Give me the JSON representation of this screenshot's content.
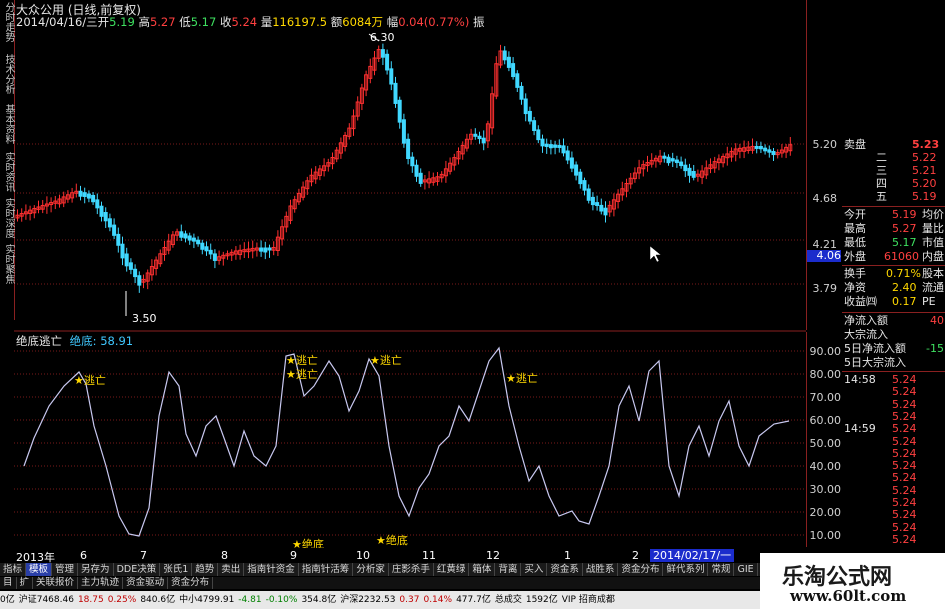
{
  "header": {
    "title": "大众公用 (日线,前复权)",
    "date": "2014/04/16/三",
    "open_label": "开",
    "open": "5.19",
    "high_label": "高",
    "high": "5.27",
    "low_label": "低",
    "low": "5.17",
    "close_label": "收",
    "close": "5.24",
    "volume_label": "量",
    "volume": "116197.5",
    "amount_label": "额",
    "amount": "6084万",
    "change_label": "幅",
    "change": "0.04(0.77%)",
    "amp_label": "振"
  },
  "left_tabs": [
    "分时走势",
    "技术分析",
    "基本资料",
    "实时资讯",
    "实时深度",
    "实时聚焦"
  ],
  "price_axis": [
    "5.20",
    "4.68",
    "4.21",
    "3.79"
  ],
  "current_price_tag": "4.06",
  "price_annotations": {
    "high": "6.30",
    "low": "3.50"
  },
  "oscillator": {
    "title": "绝底逃亡",
    "series_label": "绝底:",
    "series_value": "58.91",
    "axis": [
      "90.00",
      "80.00",
      "70.00",
      "60.00",
      "50.00",
      "40.00",
      "30.00",
      "20.00",
      "10.00"
    ],
    "escape_label": "★逃亡",
    "bottom_label": "★绝底"
  },
  "month_bar": [
    "2013年",
    "6",
    "7",
    "8",
    "9",
    "10",
    "11",
    "12",
    "1",
    "2"
  ],
  "date_tag": "2014/02/17/一",
  "panel": {
    "sell_label": "卖盘",
    "sell_price": "5.23",
    "sell_rows": [
      [
        "二",
        "5.22"
      ],
      [
        "三",
        "5.21"
      ],
      [
        "四",
        "5.20"
      ],
      [
        "五",
        "5.19"
      ]
    ],
    "stats": [
      [
        "今开",
        "5.19",
        "均价"
      ],
      [
        "最高",
        "5.27",
        "量比"
      ],
      [
        "最低",
        "5.17",
        "市值"
      ],
      [
        "外盘",
        "61060",
        "内盘"
      ],
      [
        "换手",
        "0.71%",
        "股本"
      ],
      [
        "净资",
        "2.40",
        "流通"
      ],
      [
        "收益㈣",
        "0.17",
        "PE"
      ]
    ],
    "flows": [
      [
        "净流入额",
        "40"
      ],
      [
        "大宗流入",
        ""
      ],
      [
        "5日净流入额",
        "-15"
      ],
      [
        "5日大宗流入",
        ""
      ]
    ],
    "ticks": [
      [
        "14:58",
        "5.24"
      ],
      [
        "",
        "5.24"
      ],
      [
        "",
        "5.24"
      ],
      [
        "",
        "5.24"
      ],
      [
        "14:59",
        "5.24"
      ],
      [
        "",
        "5.24"
      ],
      [
        "",
        "5.24"
      ],
      [
        "",
        "5.24"
      ],
      [
        "",
        "5.24"
      ],
      [
        "",
        "5.24"
      ],
      [
        "",
        "5.24"
      ],
      [
        "",
        "5.24"
      ],
      [
        "",
        "5.24"
      ],
      [
        "",
        "5.24"
      ]
    ]
  },
  "tabbar1": [
    "指标",
    "模板",
    "管理",
    "另存为",
    "DDE决策",
    "张氏1",
    "趋势",
    "卖出",
    "指南针资金",
    "指南针活筹",
    "分析家",
    "庄影杀手",
    "红黄绿",
    "箱体",
    "背离",
    "买入",
    "资金系",
    "战胜系",
    "资金分布",
    "鲜代系列",
    "常规",
    "GIE",
    "波"
  ],
  "tabbar2": [
    "目",
    "扩",
    "关联报价",
    "主力轨迹",
    "资金驱动",
    "资金分布"
  ],
  "ticker": [
    "0亿",
    "沪证7468.46",
    "18.75",
    "0.25%",
    "840.6亿",
    "中小4799.91",
    "-4.81",
    "-0.10%",
    "354.8亿",
    "沪深2232.53",
    "0.37",
    "0.14%",
    "477.7亿",
    "总成交",
    "1592亿",
    "VIP 招商成都"
  ],
  "watermark": {
    "cn": "乐淘公式网",
    "url": "www.60lt.com"
  }
}
